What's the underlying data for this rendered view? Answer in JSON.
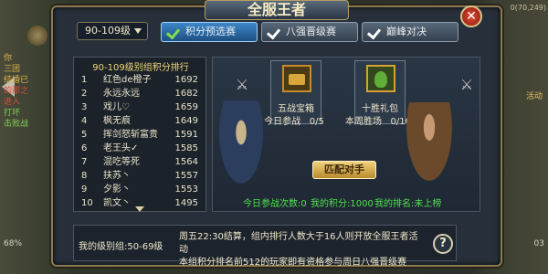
{
  "header": {
    "title": "全服王者",
    "close_label": "✕"
  },
  "level_select": {
    "value": "90-109级"
  },
  "tabs": [
    {
      "label": "积分预选赛",
      "active": true
    },
    {
      "label": "八强晋级赛",
      "active": false
    },
    {
      "label": "巅峰对决",
      "active": false
    }
  ],
  "ranking": {
    "title": "90-109级别组积分排行",
    "rows": [
      {
        "no": "1",
        "name": "红色de橙子",
        "score": "1692"
      },
      {
        "no": "2",
        "name": "永远永远",
        "score": "1682"
      },
      {
        "no": "3",
        "name": "戏儿♡",
        "score": "1659"
      },
      {
        "no": "4",
        "name": "枫无痕",
        "score": "1649"
      },
      {
        "no": "5",
        "name": "挥剑怒斩富贵",
        "score": "1591"
      },
      {
        "no": "6",
        "name": "老王头✓",
        "score": "1585"
      },
      {
        "no": "7",
        "name": "混吃等死",
        "score": "1564"
      },
      {
        "no": "8",
        "name": "扶苏丶",
        "score": "1557"
      },
      {
        "no": "9",
        "name": "夕影丶",
        "score": "1553"
      },
      {
        "no": "10",
        "name": "凯文丶",
        "score": "1495"
      }
    ]
  },
  "rewards": [
    {
      "name": "五战宝箱",
      "stat_label": "今日参战",
      "stat_value": "0/5",
      "icon": "chest-icon"
    },
    {
      "name": "十胜礼包",
      "stat_label": "本周胜场",
      "stat_value": "0/10",
      "icon": "bag-icon"
    }
  ],
  "match_button": "匹配对手",
  "stats": {
    "today_join": "今日参战次数:0",
    "my_points": "我的积分:1000",
    "my_rank": "我的排名:未上榜"
  },
  "bottom": {
    "group_label": "我的级别组:50-69级",
    "notice_line1": "周五22:30结算，组内排行人数大于16人则开放全服王者活动",
    "notice_line2": "本组积分排名前512的玩家即有资格参与周日八强晋级赛",
    "help_label": "?"
  },
  "world": {
    "left_lines": [
      "你",
      "三团",
      "结婚已",
      "的那之",
      "进入",
      "打坏",
      "击败战"
    ],
    "top_right": "0(70,249)",
    "right_act": "活动",
    "left_pct": "68%",
    "right_num": "03"
  },
  "colors": {
    "accent_blue": "#3e86c8",
    "green_text": "#4fe04f",
    "gold": "#f1d27c"
  }
}
